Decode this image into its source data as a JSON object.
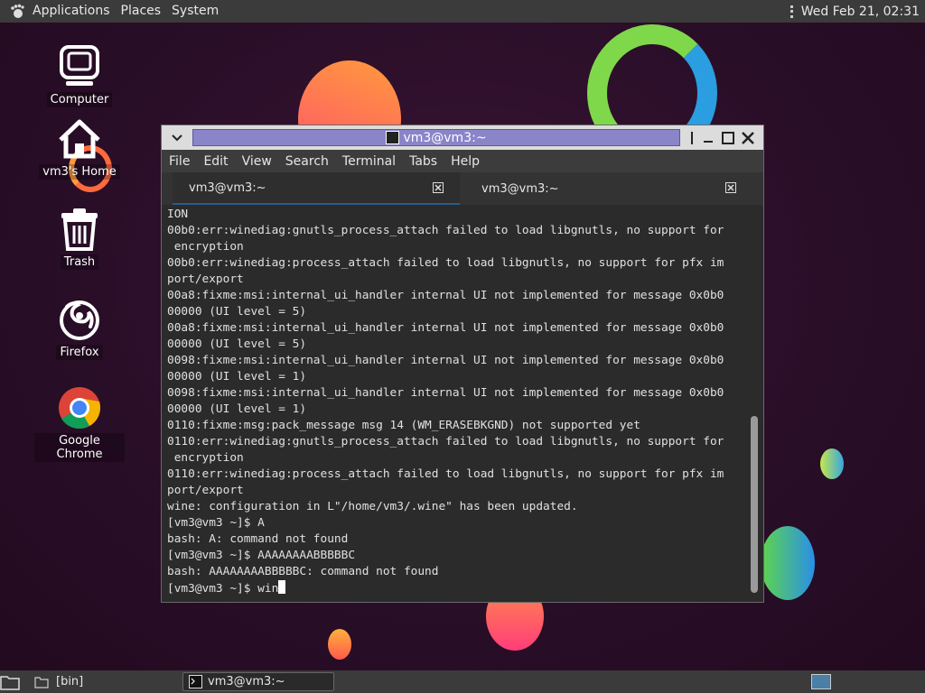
{
  "top_panel": {
    "menus": [
      "Applications",
      "Places",
      "System"
    ],
    "clock": "Wed Feb 21, 02:31"
  },
  "desktop_icons": [
    {
      "label": "Computer",
      "icon": "computer-icon"
    },
    {
      "label": "vm3's Home",
      "icon": "home-icon"
    },
    {
      "label": "Trash",
      "icon": "trash-icon"
    },
    {
      "label": "Firefox",
      "icon": "firefox-icon"
    },
    {
      "label": "Google Chrome",
      "icon": "chrome-icon"
    }
  ],
  "terminal": {
    "title": "vm3@vm3:~",
    "menu": [
      "File",
      "Edit",
      "View",
      "Search",
      "Terminal",
      "Tabs",
      "Help"
    ],
    "tabs": [
      {
        "label": "vm3@vm3:~"
      },
      {
        "label": "vm3@vm3:~"
      }
    ],
    "lines": [
      "ION",
      "00b0:err:winediag:gnutls_process_attach failed to load libgnutls, no support for",
      " encryption",
      "00b0:err:winediag:process_attach failed to load libgnutls, no support for pfx im",
      "port/export",
      "00a8:fixme:msi:internal_ui_handler internal UI not implemented for message 0x0b0",
      "00000 (UI level = 5)",
      "00a8:fixme:msi:internal_ui_handler internal UI not implemented for message 0x0b0",
      "00000 (UI level = 5)",
      "0098:fixme:msi:internal_ui_handler internal UI not implemented for message 0x0b0",
      "00000 (UI level = 1)",
      "0098:fixme:msi:internal_ui_handler internal UI not implemented for message 0x0b0",
      "00000 (UI level = 1)",
      "0110:fixme:msg:pack_message msg 14 (WM_ERASEBKGND) not supported yet",
      "0110:err:winediag:gnutls_process_attach failed to load libgnutls, no support for",
      " encryption",
      "0110:err:winediag:process_attach failed to load libgnutls, no support for pfx im",
      "port/export",
      "wine: configuration in L\"/home/vm3/.wine\" has been updated.",
      "[vm3@vm3 ~]$ A",
      "bash: A: command not found",
      "[vm3@vm3 ~]$ AAAAAAAABBBBBC",
      "bash: AAAAAAAABBBBBC: command not found"
    ],
    "prompt": "[vm3@vm3 ~]$ win"
  },
  "bottom_panel": {
    "folder_task": "[bin]",
    "terminal_task": "vm3@vm3:~"
  }
}
